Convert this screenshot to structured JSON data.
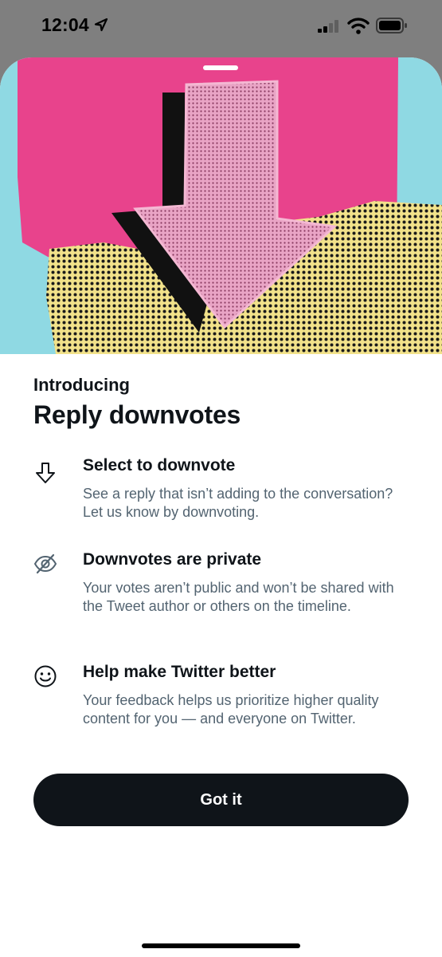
{
  "status_bar": {
    "time": "12:04"
  },
  "sheet": {
    "eyebrow": "Introducing",
    "title": "Reply downvotes",
    "features": [
      {
        "icon": "arrow-down-icon",
        "title": "Select to downvote",
        "description": "See a reply that isn’t adding to the conversation? Let us know by downvoting."
      },
      {
        "icon": "eye-slash-icon",
        "title": "Downvotes are private",
        "description": "Your votes aren’t public and won’t be shared with the Tweet author or others on the timeline."
      },
      {
        "icon": "smiley-icon",
        "title": "Help make Twitter better",
        "description": "Your feedback helps us prioritize higher quality content for you — and everyone on Twitter."
      }
    ],
    "button_label": "Got it"
  },
  "colors": {
    "hero_cyan": "#8fd9e3",
    "hero_pink": "#e8438c",
    "hero_yellow": "#f2e28a",
    "button": "#0f1419",
    "secondary_text": "#536471"
  }
}
